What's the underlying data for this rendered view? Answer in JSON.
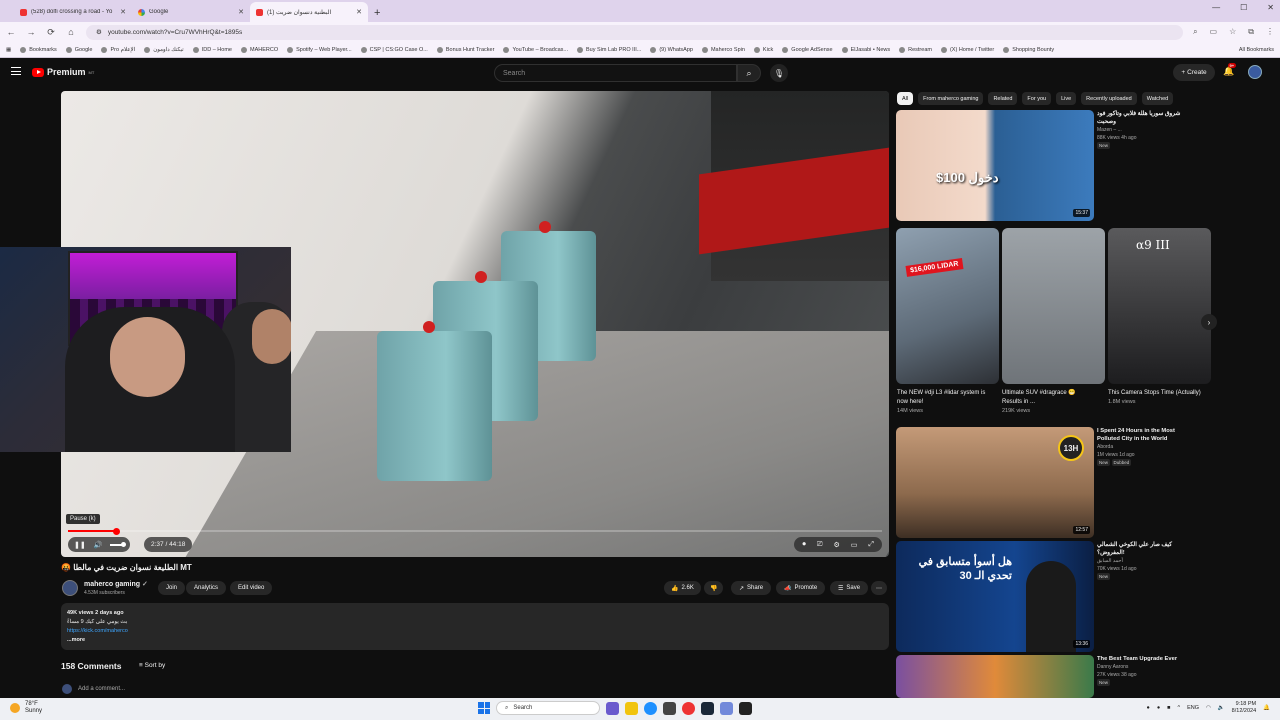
{
  "browser": {
    "tabs": [
      {
        "title": "(528) dolfi crossing a road - Yo",
        "active": false
      },
      {
        "title": "Google",
        "active": false
      },
      {
        "title": "(1) البطنية دنسوان ضريت",
        "active": true
      }
    ],
    "url": "youtube.com/watch?v=Cru7WVhHrQ&t=1895s",
    "bookmarks": [
      "Bookmarks",
      "Google",
      "Pro الإعلام",
      "تيكتك داومون",
      "IDD – Home",
      "MAHERCO",
      "Spotify – Web Player...",
      "CSP | CS:GO Case O...",
      "Bonus Hunt Tracker",
      "YouTube – Broadcas...",
      "Buy Sim Lab PRO III...",
      "(9) WhatsApp",
      "Maherco Spin",
      "Kick",
      "Google AdSense",
      "ElJasabi • News",
      "Restream",
      "(X) Home / Twitter",
      "Shopping Bounty"
    ],
    "all_bookmarks": "All Bookmarks"
  },
  "yt": {
    "logo_text": "Premium",
    "logo_sup": "MT",
    "search_placeholder": "Search",
    "create": "Create",
    "bell_badge": "9+"
  },
  "player": {
    "tooltip": "Pause (k)",
    "time": "2:37 / 44:18",
    "progress_fraction": 0.059
  },
  "video": {
    "title": "🤬 الطليعة نسوان ضريت في مالطا MT",
    "channel": "maherco gaming",
    "subs": "4.53M subscribers",
    "join": "Join",
    "analytics": "Analytics",
    "edit": "Edit video",
    "likes": "2.6K",
    "share": "Share",
    "promote": "Promote",
    "save": "Save",
    "views_date": "49K views  2 days ago",
    "desc_line": "بث يومي على كيك 9 مساءً",
    "desc_link": "https://kick.com/maherco",
    "more": "...more",
    "comments": "158 Comments",
    "sort": "Sort by",
    "add_comment": "Add a comment..."
  },
  "sidebar": {
    "chips": [
      "All",
      "From maherco gaming",
      "Related",
      "For you",
      "Live",
      "Recently uploaded",
      "Watched"
    ],
    "rec1": {
      "title": "شروق سوريا هللة فلابي وتاكور فود وصحبت",
      "channel": "Mazen – ...",
      "meta": "88K views  4h ago",
      "badge": "New",
      "duration": "15:37",
      "overlay": "دخول 100$"
    },
    "shorts": [
      {
        "title": "The NEW #dji L3 #lidar system is now here!",
        "meta": "14M views",
        "overlay": "$16,000 LIDAR"
      },
      {
        "title": "Ultimate SUV #dragrace 😁 Results in ...",
        "meta": "219K views",
        "overlay": ""
      },
      {
        "title": "This Camera Stops Time (Actually)",
        "meta": "1.8M views",
        "overlay": "α9 III"
      }
    ],
    "rec2": {
      "title": "I Spent 24 Hours in the Most Polluted City in the World",
      "channel": "Aborda",
      "meta": "1M views  1d ago",
      "badge": "New",
      "badge2": "Dubbed",
      "duration": "12:57",
      "overlay": "13H"
    },
    "rec3": {
      "title": "كيف صار علي الكوخي الشمالي المفروض؟!",
      "channel": "أحمد السابق",
      "meta": "70K views  1d ago",
      "badge": "New",
      "duration": "13:36",
      "overlay": "هل أسوأ متسابق في تحدي الـ 30"
    },
    "rec4": {
      "title": "The Best Team Upgrade Ever",
      "channel": "Danny Aarons",
      "meta": "27K views  38 ago",
      "badge": "New"
    }
  },
  "taskbar": {
    "temp": "78°F",
    "weather": "Sunny",
    "search": "Search",
    "lang": "ENG",
    "time": "9:18 PM",
    "date": "8/12/2024"
  },
  "colors": {
    "accent": "#ff0000",
    "bg": "#0f0f0f",
    "chip": "#272727",
    "link": "#3ea6ff"
  }
}
